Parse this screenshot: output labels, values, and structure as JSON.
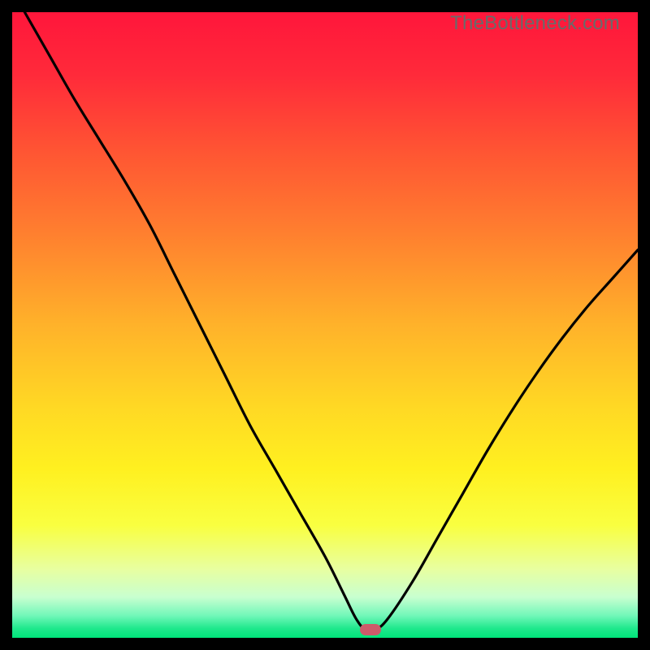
{
  "watermark": "TheBottleneck.com",
  "colors": {
    "gradient_stops": [
      {
        "offset": 0.0,
        "color": "#ff163b"
      },
      {
        "offset": 0.1,
        "color": "#ff2a3a"
      },
      {
        "offset": 0.22,
        "color": "#ff5433"
      },
      {
        "offset": 0.35,
        "color": "#ff7e2f"
      },
      {
        "offset": 0.5,
        "color": "#ffb22a"
      },
      {
        "offset": 0.63,
        "color": "#ffd824"
      },
      {
        "offset": 0.73,
        "color": "#fff020"
      },
      {
        "offset": 0.82,
        "color": "#f9ff40"
      },
      {
        "offset": 0.89,
        "color": "#e8ffa0"
      },
      {
        "offset": 0.935,
        "color": "#c8ffd0"
      },
      {
        "offset": 0.965,
        "color": "#70f7b8"
      },
      {
        "offset": 0.985,
        "color": "#1fe88c"
      },
      {
        "offset": 1.0,
        "color": "#00e47a"
      }
    ],
    "curve": "#000000",
    "marker": "#cd5b6a",
    "frame": "#000000"
  },
  "chart_data": {
    "type": "line",
    "title": "",
    "xlabel": "",
    "ylabel": "",
    "xlim": [
      0,
      100
    ],
    "ylim": [
      0,
      100
    ],
    "series": [
      {
        "name": "bottleneck-curve",
        "x": [
          2,
          6,
          10,
          14,
          18,
          22,
          26,
          30,
          34,
          38,
          42,
          46,
          50,
          53,
          55,
          56.5,
          58,
          60,
          64,
          68,
          72,
          76,
          80,
          84,
          88,
          92,
          96,
          100
        ],
        "y": [
          100,
          93,
          86,
          79.5,
          73,
          66,
          58,
          50,
          42,
          34,
          27,
          20,
          13,
          7,
          3,
          1.3,
          1.3,
          3,
          9,
          16,
          23,
          30,
          36.5,
          42.5,
          48,
          53,
          57.5,
          62
        ]
      }
    ],
    "marker": {
      "x": 57.3,
      "y": 1.3
    },
    "legend": false,
    "grid": false
  }
}
